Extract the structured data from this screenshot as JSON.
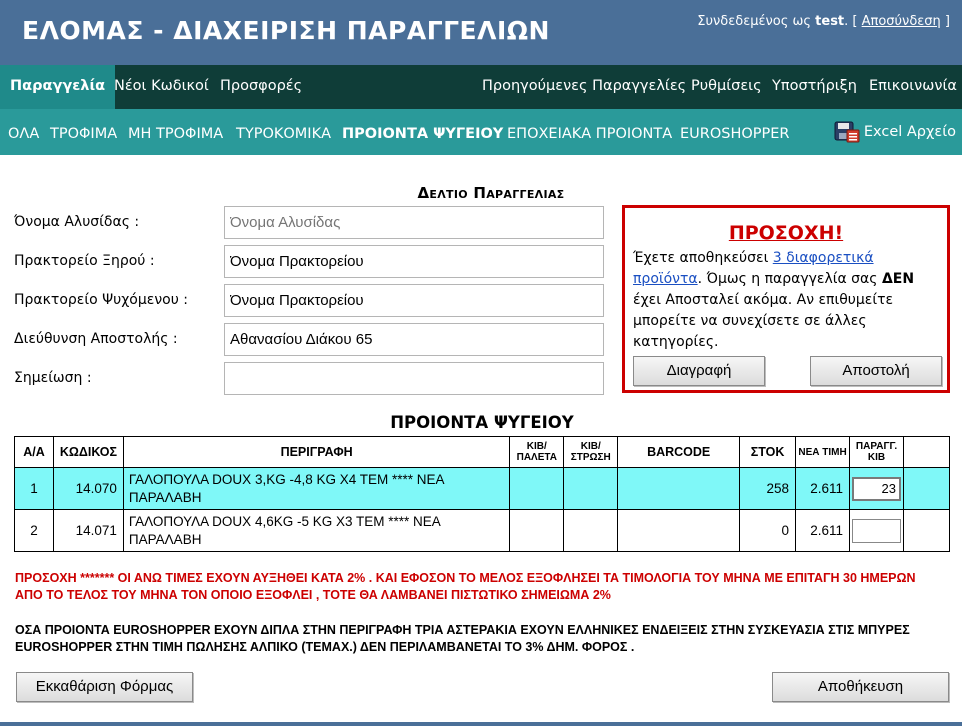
{
  "header": {
    "title": "ΕΛΟΜΑΣ - ΔΙΑΧΕΙΡΙΣΗ ΠΑΡΑΓΓΕΛΙΩΝ",
    "logged_in_prefix": "Συνδεδεμένος ως",
    "username": "test",
    "open_bracket": ". [",
    "logout_label": "Αποσύνδεση",
    "close_bracket": "]"
  },
  "nav": {
    "items": [
      "Παραγγελία",
      "Νέοι Κωδικοί",
      "Προσφορές",
      "Προηγούμενες Παραγγελίες",
      "Ρυθμίσεις",
      "Υποστήριξη",
      "Επικοινωνία"
    ],
    "active": "Παραγγελία"
  },
  "subnav": {
    "items": [
      "ΟΛΑ",
      "ΤΡΟΦΙΜΑ",
      "ΜΗ ΤΡΟΦΙΜΑ",
      "ΤΥΡΟΚΟΜΙΚΑ",
      "ΠΡΟΙΟΝΤΑ ΨΥΓΕΙΟΥ",
      "ΕΠΟΧΕΙΑΚΑ ΠΡΟΙΟΝΤΑ",
      "EUROSHOPPER"
    ],
    "active": "ΠΡΟΙΟΝΤΑ ΨΥΓΕΙΟΥ",
    "excel_label": "Excel Αρχείο"
  },
  "form": {
    "title": "Δελτιο Παραγγελιας",
    "fields": [
      {
        "label": "Όνομα Αλυσίδας :",
        "value": "",
        "placeholder": "Όνομα Αλυσίδας"
      },
      {
        "label": "Πρακτορείο Ξηρού :",
        "value": "Όνομα Πρακτορείου",
        "placeholder": ""
      },
      {
        "label": "Πρακτορείο Ψυχόμενου :",
        "value": "Όνομα Πρακτορείου",
        "placeholder": ""
      },
      {
        "label": "Διεύθυνση Αποστολής :",
        "value": "Αθανασίου Διάκου 65",
        "placeholder": ""
      },
      {
        "label": "Σημείωση :",
        "value": "",
        "placeholder": ""
      }
    ]
  },
  "warning": {
    "title": "ΠΡΟΣΟΧΗ!",
    "text_before_link": "Έχετε αποθηκεύσει",
    "link": "3 διαφορετικά προϊόντα",
    "text_mid": ". Όμως η παραγγελία σας",
    "text_bold": "ΔΕΝ",
    "text_after": "έχει Αποσταλεί ακόμα. Αν επιθυμείτε μπορείτε να συνεχίσετε σε άλλες κατηγορίες.",
    "delete_button": "Διαγραφή",
    "send_button": "Αποστολή"
  },
  "products": {
    "title": "ΠΡΟΙΟΝΤΑ ΨΥΓΕΙΟΥ",
    "columns": [
      "Α/Α",
      "ΚΩΔΙΚΟΣ",
      "ΠΕΡΙΓΡΑΦΗ",
      "ΚΙΒ/ ΠΑΛΕΤΑ",
      "ΚΙΒ/ ΣΤΡΩΣΗ",
      "BARCODE",
      "ΣΤΟΚ",
      "ΝΕΑ ΤΙΜΗ",
      "ΠΑΡΑΓΓ. ΚΙΒ",
      ""
    ],
    "rows": [
      {
        "aa": "1",
        "code": "14.070",
        "description": "ΓΑΛΟΠΟΥΛΑ DOUX 3,KG -4,8 KG X4 TEM **** ΝΕΑ ΠΑΡΑΛΑΒΗ",
        "kib_paleta": "",
        "kib_strosi": "",
        "barcode": "",
        "stock": "258",
        "price": "2.611",
        "qty": "23",
        "highlighted": true
      },
      {
        "aa": "2",
        "code": "14.071",
        "description": "ΓΑΛΟΠΟΥΛΑ DOUX 4,6KG -5 KG X3 TEM **** ΝΕΑ ΠΑΡΑΛΑΒΗ",
        "kib_paleta": "",
        "kib_strosi": "",
        "barcode": "",
        "stock": "0",
        "price": "2.611",
        "qty": "",
        "highlighted": false
      }
    ]
  },
  "notes": {
    "red": "ΠΡΟΣΟΧΗ ******* ΟΙ ΑΝΩ ΤΙΜΕΣ ΕΧΟΥΝ ΑΥΞΗΘΕΙ ΚΑΤΑ 2% . ΚΑΙ ΕΦΟΣΟΝ ΤΟ ΜΕΛΟΣ ΕΞΟΦΛΗΣΕΙ ΤΑ ΤΙΜΟΛΟΓΙΑ ΤΟΥ ΜΗΝΑ ΜΕ ΕΠΙΤΑΓΗ 30 ΗΜΕΡΩΝ ΑΠΟ ΤΟ ΤΕΛΟΣ ΤΟΥ ΜΗΝΑ ΤΟΝ ΟΠΟΙΟ ΕΞΟΦΛΕΙ , ΤΟΤΕ ΘΑ ΛΑΜΒΑΝΕΙ ΠΙΣΤΩΤΙΚΟ ΣΗΜΕΙΩΜΑ 2%",
    "black": "ΟΣΑ ΠΡΟΙΟΝΤΑ EUROSHOPPER ΕΧΟΥΝ ΔΙΠΛΑ ΣΤΗΝ ΠΕΡΙΓΡΑΦΗ ΤΡΙΑ ΑΣΤΕΡΑΚΙΑ ΕΧΟΥΝ ΕΛΛΗΝΙΚΕΣ ΕΝΔΕΙΞΕΙΣ ΣΤΗΝ ΣΥΣΚΕΥΑΣΙΑ ΣΤΙΣ ΜΠΥΡΕΣ EUROSHOPPER ΣΤΗΝ ΤΙΜΗ ΠΩΛΗΣΗΣ ΑΛΠΙΚΟ (ΤΕΜΑΧ.) ΔΕΝ ΠΕΡΙΛΑΜΒΑΝΕΤΑΙ ΤΟ 3% ΔΗΜ. ΦΟΡΟΣ ."
  },
  "buttons": {
    "clear": "Εκκαθάριση Φόρμας",
    "save": "Αποθήκευση"
  },
  "colors": {
    "header": "#4a6f98",
    "nav": "#0f3d38",
    "nav_active": "#1f8a8a",
    "subnav": "#2a9a9a",
    "warning": "#cc0000",
    "row_highlight": "#7ff8f8"
  }
}
